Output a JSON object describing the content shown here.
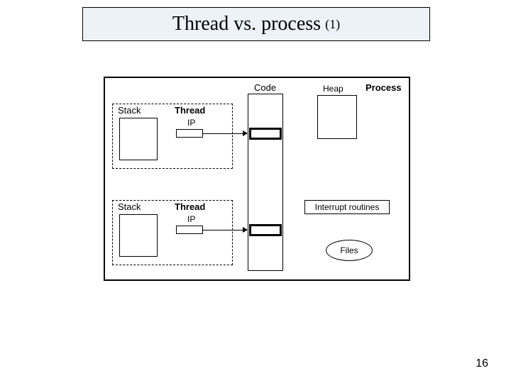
{
  "title": {
    "main": "Thread vs. process",
    "suffix": "(1)"
  },
  "labels": {
    "code": "Code",
    "heap": "Heap",
    "process": "Process",
    "stack": "Stack",
    "thread": "Thread",
    "ip": "IP",
    "interrupt": "Interrupt routines",
    "files": "Files"
  },
  "page_number": "16"
}
